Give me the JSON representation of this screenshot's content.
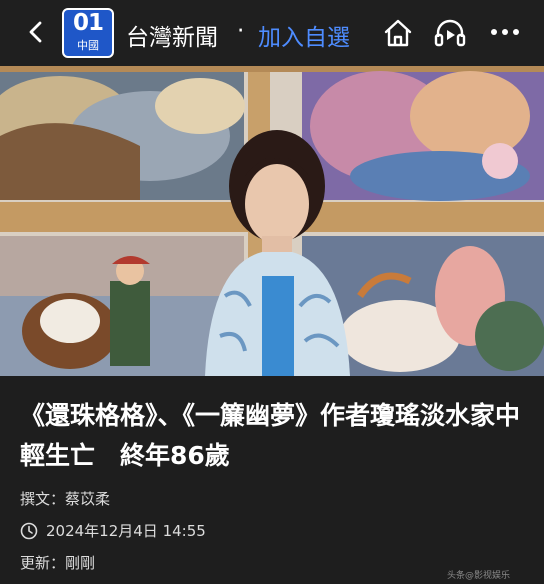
{
  "header": {
    "logo_top": "01",
    "logo_bottom": "中國",
    "source_name": "台灣新聞",
    "separator": "·",
    "follow_label": "加入自選",
    "back_icon": "chevron-left-icon",
    "home_icon": "home-icon",
    "listen_icon": "headset-play-icon",
    "more_icon": "more-dots-icon"
  },
  "article": {
    "headline": "《還珠格格》、《一簾幽夢》作者瓊瑤淡水家中輕生亡　終年86歲",
    "author": "撰文：蔡苡柔",
    "date": "2024年12月4日 14:55",
    "updated": "更新：剛剛"
  },
  "watermark": "头条@影视娱乐"
}
